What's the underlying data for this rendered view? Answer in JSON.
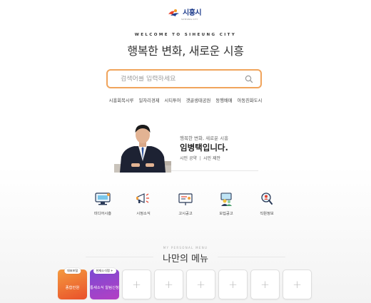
{
  "header": {
    "logo_text": "시흥시",
    "logo_sub": "SIHEUNG CITY",
    "welcome": "WELCOME TO SIHEUNG CITY",
    "headline": "행복한 변화, 새로운 시흥"
  },
  "search": {
    "placeholder": "검색어를 입력하세요"
  },
  "quick_links": [
    "시흥회복시루",
    "일자리경제",
    "시티투어",
    "갯골생태공원",
    "동행배매",
    "아동친화도시"
  ],
  "mayor": {
    "subtitle": "행복한 변화, 새로운 시흥",
    "name": "임병택입니다.",
    "link1": "시민 공약",
    "link2": "시민 제안"
  },
  "icon_menu": [
    {
      "label": "미디어시흥",
      "icon": "monitor-icon"
    },
    {
      "label": "시정소식",
      "icon": "megaphone-icon"
    },
    {
      "label": "고시공고",
      "icon": "notice-board-icon"
    },
    {
      "label": "모집공고",
      "icon": "recruit-icon"
    },
    {
      "label": "직원정보",
      "icon": "magnifier-person-icon"
    }
  ],
  "my_menu": {
    "small": "MY PERSONAL MENU",
    "title": "나만의 메뉴",
    "cards": [
      {
        "tag": "대표포털",
        "text": "종합민원",
        "style": "orange"
      },
      {
        "tag": "현재소식탭 +",
        "text": "통새소식 알림신청",
        "style": "purple"
      }
    ],
    "plus_count": 6,
    "plus_label": "+"
  },
  "colors": {
    "accent_orange": "#f0a45c",
    "logo_blue": "#1e3c8c",
    "card_orange": "#ec6a33",
    "card_purple": "#8a47cc"
  }
}
